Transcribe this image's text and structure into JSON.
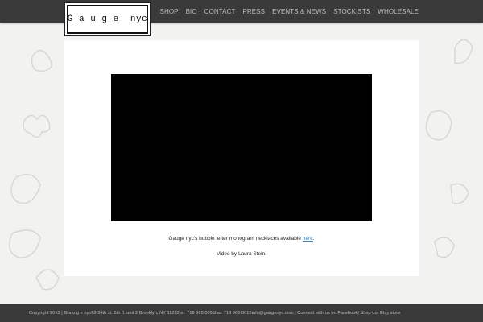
{
  "header": {
    "logo_text": "G a u g e  nyc"
  },
  "nav": {
    "items": [
      "SHOP",
      "BIO",
      "CONTACT",
      "PRESS",
      "EVENTS & NEWS",
      "STOCKISTS",
      "WHOLESALE"
    ]
  },
  "main": {
    "caption_text": "Gauge nyc's bubble letter monogram necklaces available ",
    "caption_link": "here",
    "caption_end": ".",
    "credit": "Video by Laura Stein."
  },
  "footer": {
    "text": "Copyright 2013 | G a u g e nyc68 34th st. 5th fl. unit 2 Brooklyn, NY 11232tel: 718 965 0055fax: 718 965 0015info@gaugenyc.com | Connect with us on Facebook| Shop our Etsy store"
  },
  "colors": {
    "bar": "#3a3a3a",
    "nav_text": "#bdbdbd",
    "link": "#3b7fb5",
    "video": "#000000"
  }
}
